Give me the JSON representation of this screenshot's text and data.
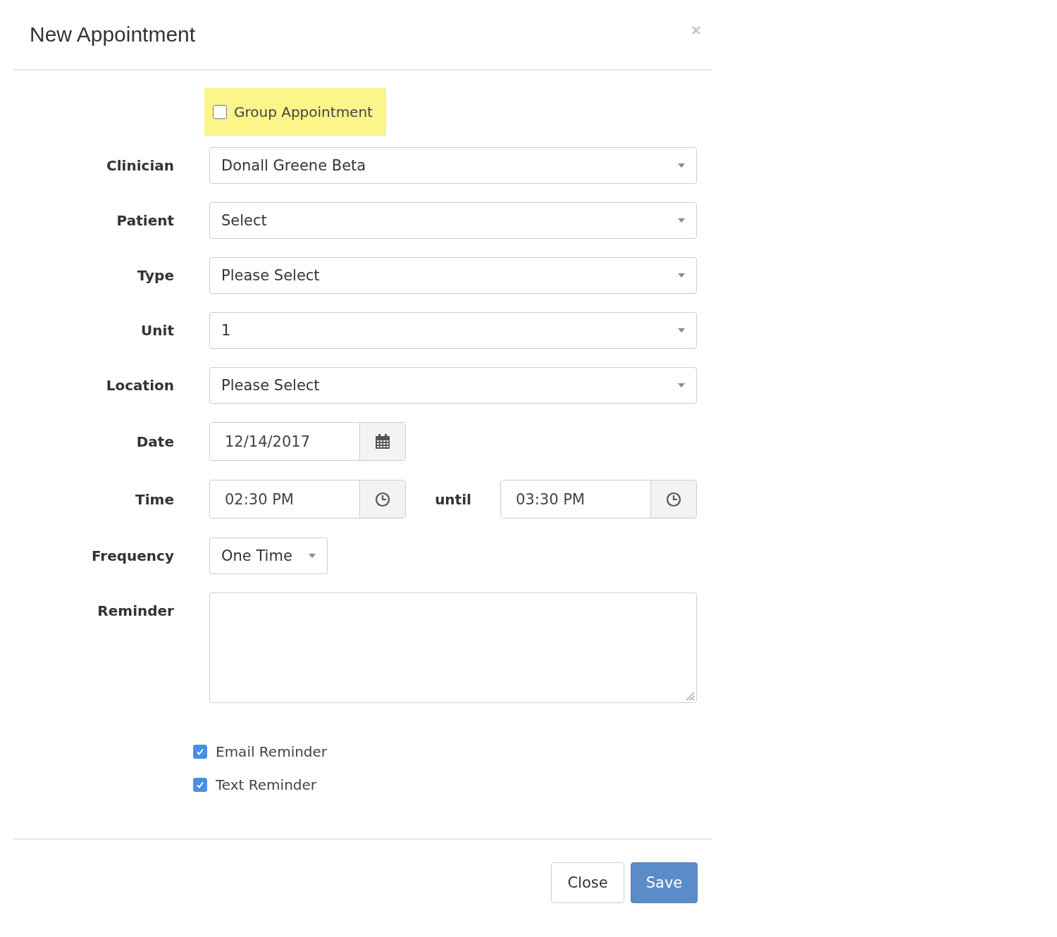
{
  "dialog": {
    "title": "New Appointment"
  },
  "group_option": {
    "label": "Group Appointment",
    "checked": false,
    "highlighted": true
  },
  "fields": [
    {
      "kind": "select",
      "label": "Clinician",
      "value": "Donall Greene Beta"
    },
    {
      "kind": "select",
      "label": "Patient",
      "value": "Select"
    },
    {
      "kind": "select",
      "label": "Type",
      "value": "Please Select"
    },
    {
      "kind": "select",
      "label": "Unit",
      "value": "1"
    },
    {
      "kind": "select",
      "label": "Location",
      "value": "Please Select"
    },
    {
      "kind": "date",
      "label": "Date",
      "value": "12/14/2017"
    },
    {
      "kind": "time_range",
      "label": "Time",
      "start": "02:30 PM",
      "separator": "until",
      "end": "03:30 PM"
    },
    {
      "kind": "compact_select",
      "label": "Frequency",
      "value": "One Time"
    },
    {
      "kind": "textarea",
      "label": "Reminder"
    }
  ],
  "reminders": [
    {
      "label": "Email Reminder",
      "checked": true
    },
    {
      "label": "Text Reminder",
      "checked": true
    }
  ],
  "buttons": [
    {
      "label": "Close",
      "kind": "default"
    },
    {
      "label": "Save",
      "kind": "primary"
    }
  ]
}
